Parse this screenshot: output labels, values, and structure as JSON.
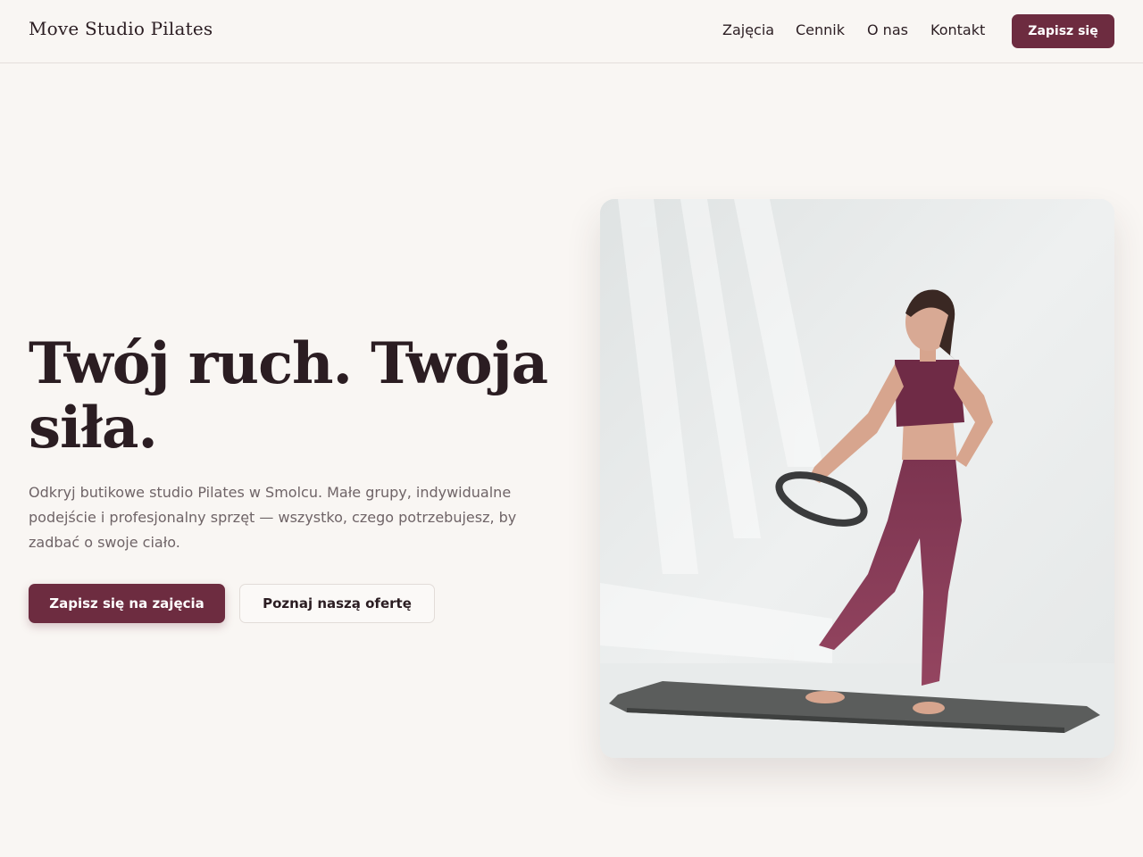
{
  "header": {
    "brand": "Move Studio Pilates",
    "nav": [
      "Zajęcia",
      "Cennik",
      "O nas",
      "Kontakt"
    ],
    "cta_label": "Zapisz się"
  },
  "hero": {
    "title": "Twój ruch. Twoja siła.",
    "description": "Odkryj butikowe studio Pilates w Smolcu. Małe grupy, indywidualne podejście i profesjonalny sprzęt — wszystko, czego potrzebujesz, by zadbać o swoje ciało.",
    "primary_button": "Zapisz się na zajęcia",
    "secondary_button": "Poznaj naszą ofertę",
    "image_description": "photo-pilates-instructor-with-ring"
  },
  "colors": {
    "accent": "#6d2c40",
    "background": "#f9f6f3",
    "text": "#2b1d22",
    "muted_text": "#6f6467"
  }
}
